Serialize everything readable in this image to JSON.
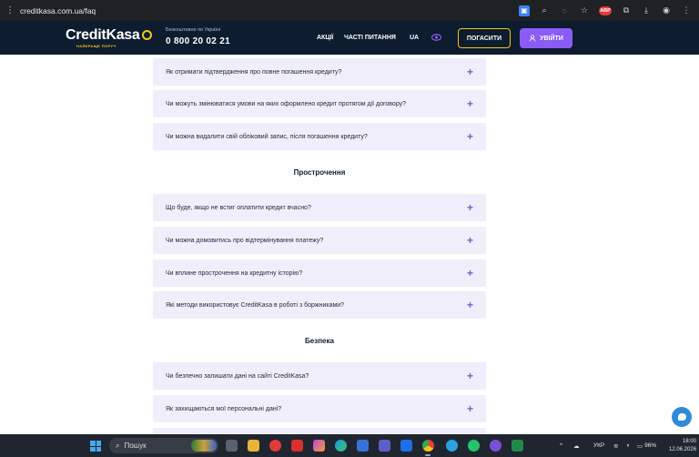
{
  "browser": {
    "url": "creditkasa.com.ua/faq",
    "ext_badge": "ABP"
  },
  "header": {
    "logo_credit": "Credit",
    "logo_kasa": "Kasa",
    "logo_tagline": "НАЙКРАЩЕ ПОРУЧ",
    "phone_caption": "Безкоштовно по Україні",
    "phone": "0 800 20 02 21",
    "nav": [
      "АКЦІЇ",
      "ЧАСТІ ПИТАННЯ",
      "UA"
    ],
    "pay_button": "ПОГАСИТИ",
    "login_button": "УВІЙТИ"
  },
  "faq": {
    "group1": [
      "Як отримати підтвердження про повне погашення кредиту?",
      "Чи можуть змінюватися умови на яких оформлено кредит протягом дії договору?",
      "Чи можна видалити свій обліковий запис, після погашення кредиту?"
    ],
    "section2_title": "Прострочення",
    "group2": [
      "Що буде, якщо не встиг оплатити кредит вчасно?",
      "Чи можна домовитись про відтермінування платежу?",
      "Чи вплине прострочення на кредитну історію?",
      "Які методи використовує CreditKasa в роботі з боржниками?"
    ],
    "section3_title": "Безпека",
    "group3": [
      "Чи безпечно залишати дані на сайті CreditKasa?",
      "Як захищаються мої персональні дані?"
    ],
    "plus": "+"
  },
  "taskbar": {
    "search_label": "Пошук",
    "lang": "УКР",
    "battery": "96%",
    "time": "18:00",
    "date": "12.06.2026"
  },
  "colors": {
    "header_bg": "#0d1c2e",
    "accent_yellow": "#f5c518",
    "accent_purple": "#8a5cf5",
    "faq_bg": "#f0eefa"
  }
}
